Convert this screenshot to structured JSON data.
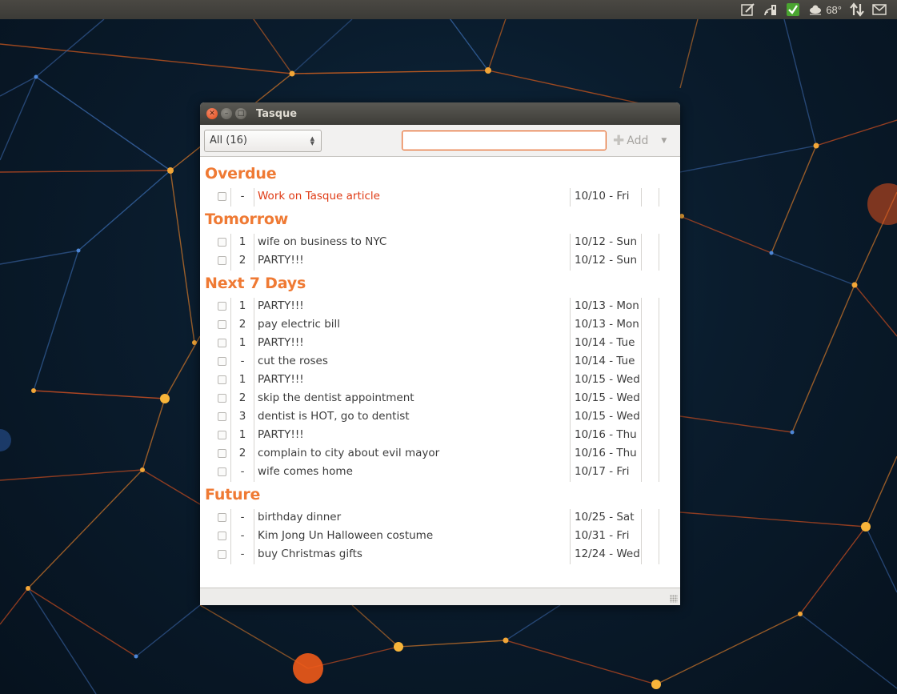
{
  "panel": {
    "temperature": "68°"
  },
  "window": {
    "title": "Tasque"
  },
  "toolbar": {
    "category_selected": "All (16)",
    "search_value": "",
    "add_label": "Add"
  },
  "sections": [
    {
      "title": "Overdue",
      "tasks": [
        {
          "priority": "-",
          "name": "Work on Tasque article",
          "due": "10/10 - Fri",
          "overdue": true
        }
      ]
    },
    {
      "title": "Tomorrow",
      "tasks": [
        {
          "priority": "1",
          "name": "wife on business to NYC",
          "due": "10/12 - Sun"
        },
        {
          "priority": "2",
          "name": "PARTY!!!",
          "due": "10/12 - Sun"
        }
      ]
    },
    {
      "title": "Next 7 Days",
      "tasks": [
        {
          "priority": "1",
          "name": "PARTY!!!",
          "due": "10/13 - Mon"
        },
        {
          "priority": "2",
          "name": "pay electric bill",
          "due": "10/13 - Mon"
        },
        {
          "priority": "1",
          "name": "PARTY!!!",
          "due": "10/14 - Tue"
        },
        {
          "priority": "-",
          "name": "cut the roses",
          "due": "10/14 - Tue"
        },
        {
          "priority": "1",
          "name": "PARTY!!!",
          "due": "10/15 - Wed"
        },
        {
          "priority": "2",
          "name": "skip the dentist appointment",
          "due": "10/15 - Wed"
        },
        {
          "priority": "3",
          "name": "dentist is HOT, go to dentist",
          "due": "10/15 - Wed"
        },
        {
          "priority": "1",
          "name": "PARTY!!!",
          "due": "10/16 - Thu"
        },
        {
          "priority": "2",
          "name": "complain to city about evil mayor",
          "due": "10/16 - Thu"
        },
        {
          "priority": "-",
          "name": "wife comes home",
          "due": "10/17 - Fri"
        }
      ]
    },
    {
      "title": "Future",
      "tasks": [
        {
          "priority": "-",
          "name": "birthday dinner",
          "due": "10/25 - Sat"
        },
        {
          "priority": "-",
          "name": "Kim Jong Un Halloween costume",
          "due": "10/31 - Fri"
        },
        {
          "priority": "-",
          "name": "buy Christmas gifts",
          "due": "12/24 - Wed"
        }
      ]
    }
  ],
  "colors": {
    "section_header": "#ef7a34",
    "overdue_text": "#df3a14",
    "accent": "#e66a2c",
    "titlebar": "#3d3c38"
  }
}
